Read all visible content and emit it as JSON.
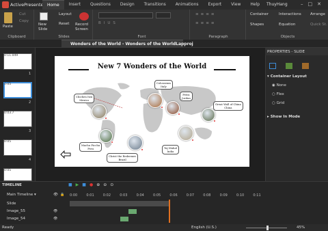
{
  "app": {
    "name": "ActivePresenter",
    "user": "ThuyHang"
  },
  "menu": [
    "Home",
    "Insert",
    "Questions",
    "Design",
    "Transitions",
    "Animations",
    "Export",
    "View",
    "Help"
  ],
  "ribbon": {
    "paste": "Paste",
    "cut": "Cut",
    "copy": "Copy",
    "clipboard": "Clipboard",
    "new_slide": "New Slide",
    "layout": "Layout",
    "reset": "Reset",
    "slides": "Slides",
    "record_screen": "Record Screen",
    "font": "Font",
    "paragraph": "Paragraph",
    "container": "Container",
    "interactions": "Interactions",
    "arrange": "Arrange",
    "shapes": "Shapes",
    "equation": "Equation",
    "quick_style": "Quick St.",
    "objects": "Objects"
  },
  "document_tab": "Wonders of the World - Wonders of the WorldLapproj",
  "slides": [
    {
      "num": "1",
      "time": "0:11.049"
    },
    {
      "num": "2",
      "time": "0:05"
    },
    {
      "num": "3",
      "time": "0:03.7"
    },
    {
      "num": "4",
      "time": "0:05"
    },
    {
      "num": "5",
      "time": "0:05"
    }
  ],
  "slide": {
    "title": "New 7 Wonders of the World",
    "wonders": [
      {
        "name": "Chichen Itzá\nMexico"
      },
      {
        "name": "Colosseum\nItaly"
      },
      {
        "name": "Petra\nJordan"
      },
      {
        "name": "Great Wall of China\nChina"
      },
      {
        "name": "Machu Picchu\nPeru"
      },
      {
        "name": "Christ the Redeemer\nBrazil"
      },
      {
        "name": "Taj Mahal\nIndia"
      }
    ]
  },
  "properties": {
    "header": "PROPERTIES - SLIDE",
    "section": "Container Layout",
    "options": [
      "None",
      "Flex",
      "Grid"
    ],
    "selected": "None",
    "show_in_mode": "Show In Mode"
  },
  "timeline": {
    "label": "TIMELINE",
    "main": "Main Timeline",
    "ticks": [
      "0:00",
      "0:01",
      "0:02",
      "0:03",
      "0:04",
      "0:05",
      "0:06",
      "0:07",
      "0:08",
      "0:09",
      "0:10",
      "0:11"
    ],
    "rows": [
      "Slide",
      "Image_55",
      "Image_54"
    ]
  },
  "status": {
    "ready": "Ready",
    "language": "English (U.S.)",
    "zoom": "45%"
  }
}
